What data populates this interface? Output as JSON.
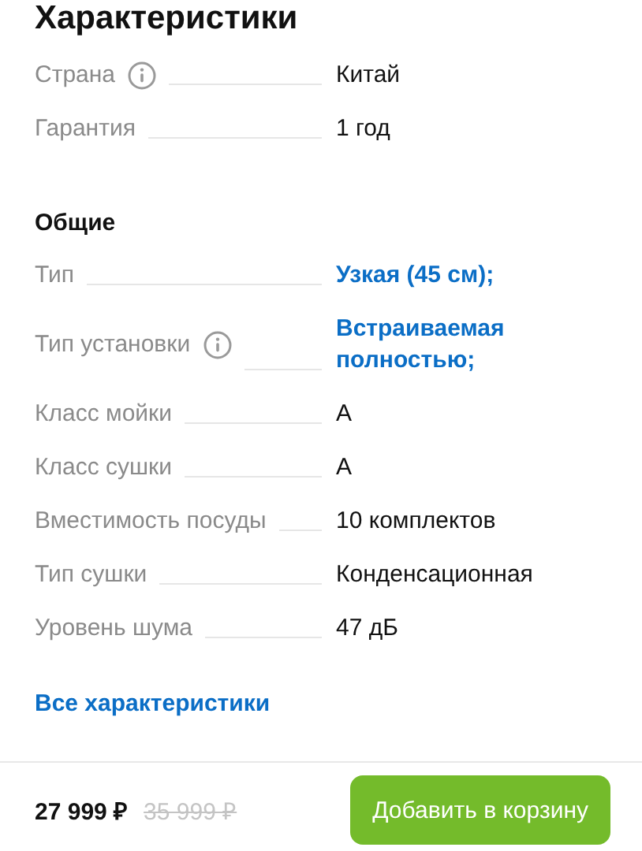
{
  "title": "Характеристики",
  "sections": [
    {
      "rows": [
        {
          "label": "Страна",
          "info": true,
          "value": "Китай",
          "kind": "text"
        },
        {
          "label": "Гарантия",
          "info": false,
          "value": "1 год",
          "kind": "text"
        }
      ]
    },
    {
      "heading": "Общие",
      "rows": [
        {
          "label": "Тип",
          "info": false,
          "value": "Узкая (45 см);",
          "kind": "link"
        },
        {
          "label": "Тип установки",
          "info": true,
          "value": "Встраиваемая полностью;",
          "kind": "link"
        },
        {
          "label": "Класс мойки",
          "info": false,
          "value": "A",
          "kind": "text"
        },
        {
          "label": "Класс сушки",
          "info": false,
          "value": "A",
          "kind": "text"
        },
        {
          "label": "Вместимость посуды",
          "info": false,
          "value": "10 комплектов",
          "kind": "text"
        },
        {
          "label": "Тип сушки",
          "info": false,
          "value": "Конденсационная",
          "kind": "text"
        },
        {
          "label": "Уровень шума",
          "info": false,
          "value": "47 дБ",
          "kind": "text"
        }
      ]
    }
  ],
  "all_link": "Все характеристики",
  "footer": {
    "price": "27 999 ₽",
    "old_price": "35 999 ₽",
    "button": "Добавить в корзину"
  }
}
